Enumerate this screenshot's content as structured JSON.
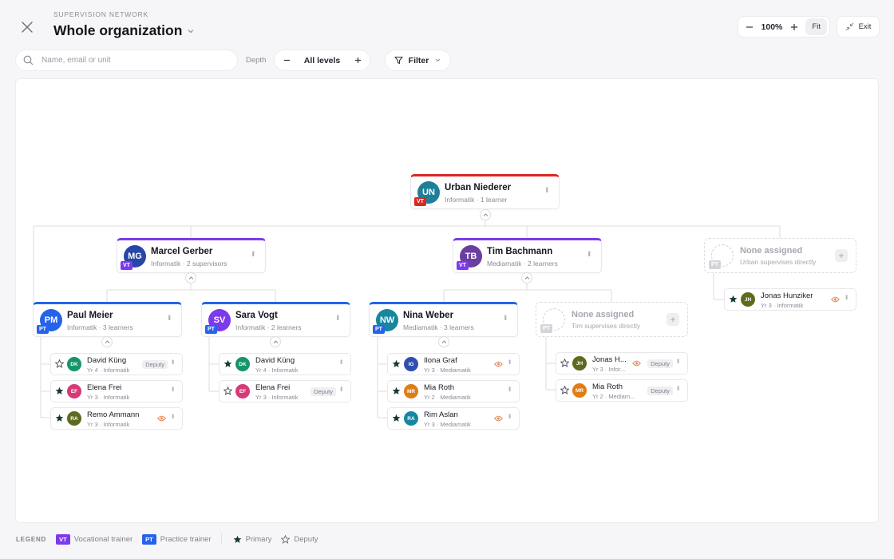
{
  "header": {
    "eyebrow": "SUPERVISION NETWORK",
    "title": "Whole organization"
  },
  "zoom": {
    "value": "100%",
    "fit_label": "Fit"
  },
  "exit_label": "Exit",
  "search": {
    "placeholder": "Name, email or unit",
    "value": ""
  },
  "depth": {
    "label": "Depth",
    "value": "All levels"
  },
  "filter_label": "Filter",
  "colors": {
    "vt": "#7c3aed",
    "pt": "#2563eb",
    "root_accent": "#dc2626",
    "primary_star": "#163a3a",
    "watch": "#e8885a"
  },
  "root": {
    "initials": "UN",
    "name": "Urban Niederer",
    "sub": "Informatik · 1 learner",
    "role": "VT",
    "avatar_color": "#1e7f96"
  },
  "vts": [
    {
      "initials": "MG",
      "name": "Marcel Gerber",
      "sub": "Informatik · 2 supervisors",
      "role": "VT",
      "avatar_color": "#2746a6"
    },
    {
      "initials": "TB",
      "name": "Tim Bachmann",
      "sub": "Mediamatik · 2 learners",
      "role": "VT",
      "avatar_color": "#6b3fa0"
    }
  ],
  "placeholders": [
    {
      "name": "None assigned",
      "sub": "Urban supervises directly",
      "role": "PT"
    },
    {
      "name": "None assigned",
      "sub": "Tim supervises directly",
      "role": "PT"
    }
  ],
  "pts": [
    {
      "initials": "PM",
      "name": "Paul Meier",
      "sub": "Informatik · 3 learners",
      "role": "PT",
      "avatar_color": "#2563eb"
    },
    {
      "initials": "SV",
      "name": "Sara Vogt",
      "sub": "Informatik · 2 learners",
      "role": "PT",
      "avatar_color": "#7c3aed"
    },
    {
      "initials": "NW",
      "name": "Nina Weber",
      "sub": "Mediamatik · 3 learners",
      "role": "PT",
      "avatar_color": "#1787a0"
    }
  ],
  "learners": {
    "urban": [
      {
        "initials": "JH",
        "name": "Jonas Hunziker",
        "sub": "Yr 3 · Informatik",
        "primary": true,
        "watch": true,
        "tag": "",
        "avatar_color": "#5c6b1e"
      }
    ],
    "paul": [
      {
        "initials": "DK",
        "name": "David Küng",
        "sub": "Yr 4 · Informatik",
        "primary": false,
        "watch": false,
        "tag": "Deputy",
        "avatar_color": "#15956a"
      },
      {
        "initials": "EF",
        "name": "Elena Frei",
        "sub": "Yr 3 · Informatik",
        "primary": true,
        "watch": false,
        "tag": "",
        "avatar_color": "#d63a78"
      },
      {
        "initials": "RA",
        "name": "Remo Ammann",
        "sub": "Yr 3 · Informatik",
        "primary": true,
        "watch": true,
        "tag": "",
        "avatar_color": "#5c6b1e"
      }
    ],
    "sara": [
      {
        "initials": "DK",
        "name": "David Küng",
        "sub": "Yr 4 · Informatik",
        "primary": true,
        "watch": false,
        "tag": "",
        "avatar_color": "#15956a"
      },
      {
        "initials": "EF",
        "name": "Elena Frei",
        "sub": "Yr 3 · Informatik",
        "primary": false,
        "watch": false,
        "tag": "Deputy",
        "avatar_color": "#d63a78"
      }
    ],
    "nina": [
      {
        "initials": "IG",
        "name": "Ilona Graf",
        "sub": "Yr 3 · Mediamatik",
        "primary": true,
        "watch": true,
        "tag": "",
        "avatar_color": "#2f4fb0"
      },
      {
        "initials": "MR",
        "name": "Mia Roth",
        "sub": "Yr 2 · Mediamatik",
        "primary": true,
        "watch": false,
        "tag": "",
        "avatar_color": "#e07d16"
      },
      {
        "initials": "RA",
        "name": "Rim Aslan",
        "sub": "Yr 3 · Mediamatik",
        "primary": true,
        "watch": true,
        "tag": "",
        "avatar_color": "#1787a0"
      }
    ],
    "tim": [
      {
        "initials": "JH",
        "name": "Jonas H...",
        "sub": "Yr 3 · Infor...",
        "primary": false,
        "watch": true,
        "tag": "Deputy",
        "avatar_color": "#5c6b1e"
      },
      {
        "initials": "MR",
        "name": "Mia Roth",
        "sub": "Yr 2 · Mediam...",
        "primary": false,
        "watch": false,
        "tag": "Deputy",
        "avatar_color": "#e07d16"
      }
    ]
  },
  "legend": {
    "heading": "LEGEND",
    "vt_chip": "VT",
    "vt_label": "Vocational trainer",
    "pt_chip": "PT",
    "pt_label": "Practice trainer",
    "primary_label": "Primary",
    "deputy_label": "Deputy"
  }
}
